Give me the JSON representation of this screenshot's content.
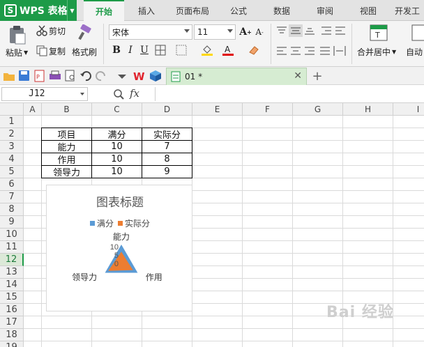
{
  "app": {
    "logo": "WPS 表格",
    "tabs": [
      "开始",
      "插入",
      "页面布局",
      "公式",
      "数据",
      "审阅",
      "视图",
      "开发工"
    ]
  },
  "ribbon": {
    "paste_label": "粘贴",
    "cut_label": "剪切",
    "copy_label": "复制",
    "format_painter_label": "格式刷",
    "font_name": "宋体",
    "font_size": "11",
    "bold": "B",
    "italic": "I",
    "underline": "U",
    "merge_label": "合并居中",
    "wrap_label": "自动"
  },
  "document_tab": {
    "title": "01 *"
  },
  "formula_bar": {
    "cell_reference": "J12",
    "fx_label": "fx",
    "formula": ""
  },
  "grid": {
    "columns": [
      "A",
      "B",
      "C",
      "D",
      "E",
      "F",
      "G",
      "H",
      "I"
    ],
    "rows": [
      "1",
      "2",
      "3",
      "4",
      "5",
      "6",
      "7",
      "8",
      "9",
      "10",
      "11",
      "12",
      "13",
      "14",
      "15",
      "16",
      "17",
      "18",
      "19"
    ],
    "selected_row": "12",
    "table": {
      "headers": [
        "项目",
        "满分",
        "实际分"
      ],
      "rows": [
        [
          "能力",
          "10",
          "7"
        ],
        [
          "作用",
          "10",
          "8"
        ],
        [
          "领导力",
          "10",
          "9"
        ]
      ]
    }
  },
  "chart": {
    "title": "图表标题",
    "legend": [
      "满分",
      "实际分"
    ],
    "axis_ticks": [
      "10",
      "5",
      "0"
    ],
    "categories": [
      "能力",
      "作用",
      "领导力"
    ],
    "colors": {
      "series1": "#5b9bd5",
      "series2": "#ed7d31"
    }
  },
  "chart_data": {
    "type": "radar",
    "title": "图表标题",
    "categories": [
      "能力",
      "作用",
      "领导力"
    ],
    "series": [
      {
        "name": "满分",
        "values": [
          10,
          10,
          10
        ]
      },
      {
        "name": "实际分",
        "values": [
          7,
          8,
          9
        ]
      }
    ],
    "ylim": [
      0,
      10
    ],
    "ticks": [
      0,
      5,
      10
    ],
    "legend_position": "top"
  },
  "watermark": "Bai 经验"
}
